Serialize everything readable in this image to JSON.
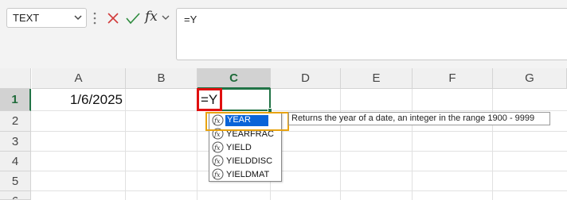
{
  "name_box": {
    "value": "TEXT"
  },
  "formula_bar": {
    "fx_label": "fx",
    "content": "=Y"
  },
  "columns": [
    "A",
    "B",
    "C",
    "D",
    "E",
    "F",
    "G"
  ],
  "rows": [
    "1",
    "2",
    "3",
    "4",
    "5",
    "6"
  ],
  "cells": {
    "A1": "1/6/2025",
    "C1": "=Y"
  },
  "autocomplete": {
    "items": [
      "YEAR",
      "YEARFRAC",
      "YIELD",
      "YIELDDISC",
      "YIELDMAT"
    ],
    "selected": "YEAR",
    "tooltip": "Returns the year of a date, an integer in the range 1900 - 9999"
  },
  "colors": {
    "accent": "#217346",
    "edit_border": "#e01010",
    "highlight": "#0a64d8",
    "callout": "#e8a310"
  }
}
